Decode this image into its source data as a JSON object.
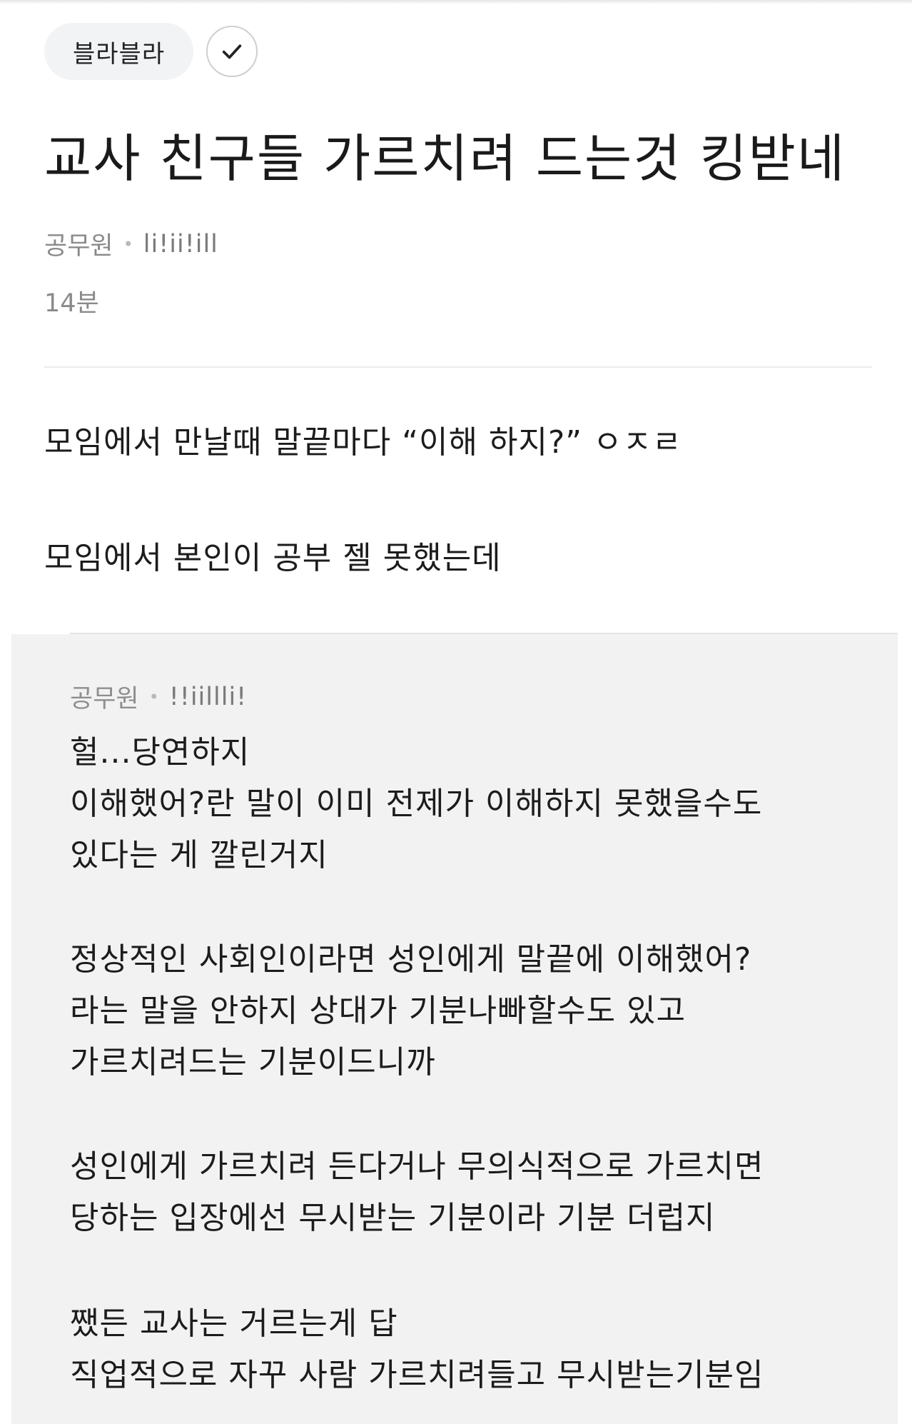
{
  "header": {
    "category_chip": "블라블라",
    "follow_icon": "checkmark-icon"
  },
  "post": {
    "title": "교사 친구들 가르치려 드는것 킹받네",
    "author_company": "공무원",
    "author_nickname": "li!ii!ill",
    "time_ago": "14분",
    "body_lines": [
      "모임에서 만날때 말끝마다 “이해 하지?” ㅇㅈㄹ",
      "모임에서 본인이 공부 젤 못했는데"
    ]
  },
  "comment": {
    "author_company": "공무원",
    "author_nickname": "!!iillli!",
    "lines": [
      "헐...당연하지",
      "이해했어?란 말이 이미 전제가 이해하지 못했을수도",
      "있다는 게 깔린거지",
      "정상적인 사회인이라면 성인에게 말끝에 이해했어?",
      "라는 말을 안하지 상대가 기분나빠할수도 있고",
      "가르치려드는 기분이드니까",
      "성인에게 가르치려 든다거나 무의식적으로 가르치면",
      "당하는 입장에선 무시받는 기분이라 기분 더럽지",
      "쨌든 교사는 거르는게 답",
      "직업적으로 자꾸 사람 가르치려들고 무시받는기분임"
    ]
  }
}
